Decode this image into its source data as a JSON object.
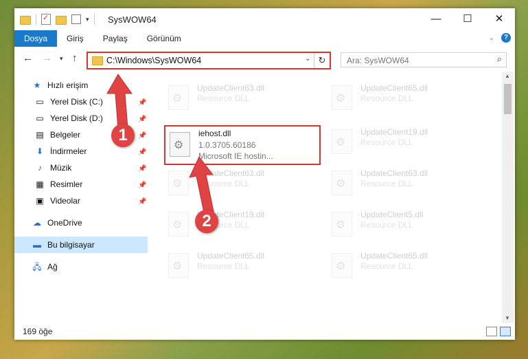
{
  "window": {
    "title": "SysWOW64",
    "minimize_glyph": "—",
    "maximize_glyph": "☐",
    "close_glyph": "✕"
  },
  "ribbon": {
    "tabs": [
      "Dosya",
      "Giriş",
      "Paylaş",
      "Görünüm"
    ],
    "active_tab": "Dosya",
    "accent": "#1979ca"
  },
  "address": {
    "path": "C:\\Windows\\SysWOW64",
    "search_placeholder": "Ara: SysWOW64"
  },
  "nav": {
    "items": [
      {
        "label": "Hızlı erişim",
        "icon": "star-icon",
        "pinned": false
      },
      {
        "label": "Yerel Disk (C:)",
        "icon": "drive-icon",
        "pinned": true
      },
      {
        "label": "Yerel Disk (D:)",
        "icon": "drive-icon",
        "pinned": true
      },
      {
        "label": "Belgeler",
        "icon": "documents-icon",
        "pinned": true
      },
      {
        "label": "İndirmeler",
        "icon": "download-icon",
        "pinned": true
      },
      {
        "label": "Müzik",
        "icon": "music-icon",
        "pinned": true
      },
      {
        "label": "Resimler",
        "icon": "pictures-icon",
        "pinned": true
      },
      {
        "label": "Videolar",
        "icon": "video-icon",
        "pinned": true
      },
      {
        "label": "OneDrive",
        "icon": "cloud-icon",
        "pinned": false
      },
      {
        "label": "Bu bilgisayar",
        "icon": "computer-icon",
        "pinned": false,
        "selected": true
      },
      {
        "label": "Ağ",
        "icon": "network-icon",
        "pinned": false
      }
    ]
  },
  "files": {
    "highlighted": {
      "name": "iehost.dll",
      "version": "1.0.3705.60186",
      "description": "Microsoft IE hostin..."
    },
    "background": [
      {
        "name": "UpdateClient63.dll",
        "type": "Resource DLL"
      },
      {
        "name": "UpdateClient65.dll",
        "type": "Resource DLL"
      },
      {
        "name": "UpdateClient19.dll",
        "type": "Resource DLL"
      },
      {
        "name": "UpdateClient63.dll",
        "type": "Resource DLL"
      },
      {
        "name": "UpdateClient63.dll",
        "type": "Resource DLL"
      },
      {
        "name": "UpdateClient19.dll",
        "type": "Resource DLL"
      },
      {
        "name": "UpdateClient5.dll",
        "type": "Resource DLL"
      },
      {
        "name": "UpdateClient65.dll",
        "type": "Resource DLL"
      },
      {
        "name": "UpdateClient65.dll",
        "type": "Resource DLL"
      }
    ]
  },
  "status": {
    "item_count": "169 öğe"
  },
  "annotations": {
    "badge1": "1",
    "badge2": "2",
    "color": "#e04343"
  }
}
